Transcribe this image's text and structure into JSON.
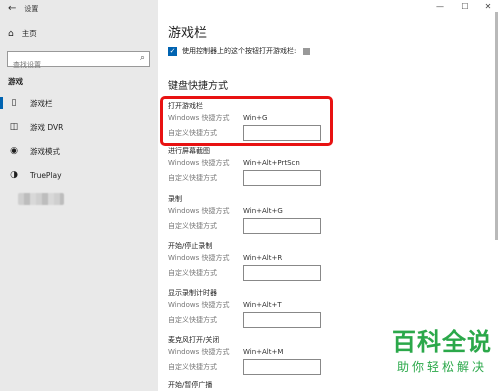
{
  "window": {
    "title": "设置",
    "minimize": "—",
    "maximize": "☐",
    "close": "✕"
  },
  "sidebar": {
    "home_label": "主页",
    "search_placeholder": "查找设置",
    "section_label": "游戏",
    "items": [
      {
        "label": "游戏栏",
        "icon": "gamebar-icon",
        "glyph": "▯"
      },
      {
        "label": "游戏 DVR",
        "icon": "dvr-icon",
        "glyph": "◫"
      },
      {
        "label": "游戏模式",
        "icon": "gamemode-icon",
        "glyph": "◉"
      },
      {
        "label": "TruePlay",
        "icon": "trueplay-icon",
        "glyph": "◑"
      }
    ]
  },
  "main": {
    "title": "游戏栏",
    "checkbox_label": "使用控制器上的这个按钮打开游戏栏:",
    "checkbox_checked": true,
    "section_title": "键盘快捷方式",
    "windows_shortcut_label": "Windows 快捷方式",
    "custom_shortcut_label": "自定义快捷方式",
    "shortcuts": [
      {
        "name": "打开游戏栏",
        "win": "Win+G"
      },
      {
        "name": "进行屏幕截图",
        "win": "Win+Alt+PrtScn"
      },
      {
        "name": "录制",
        "win": "Win+Alt+G"
      },
      {
        "name": "开始/停止录制",
        "win": "Win+Alt+R"
      },
      {
        "name": "显示录制计时器",
        "win": "Win+Alt+T"
      },
      {
        "name": "麦克风打开/关闭",
        "win": "Win+Alt+M"
      },
      {
        "name": "开始/暂停广播",
        "win": ""
      }
    ]
  },
  "watermark": {
    "logo": "百科全说",
    "sub": "助你轻松解决"
  },
  "colors": {
    "accent": "#0063b1",
    "highlight": "#e81212",
    "watermark": "#2ba84a"
  }
}
